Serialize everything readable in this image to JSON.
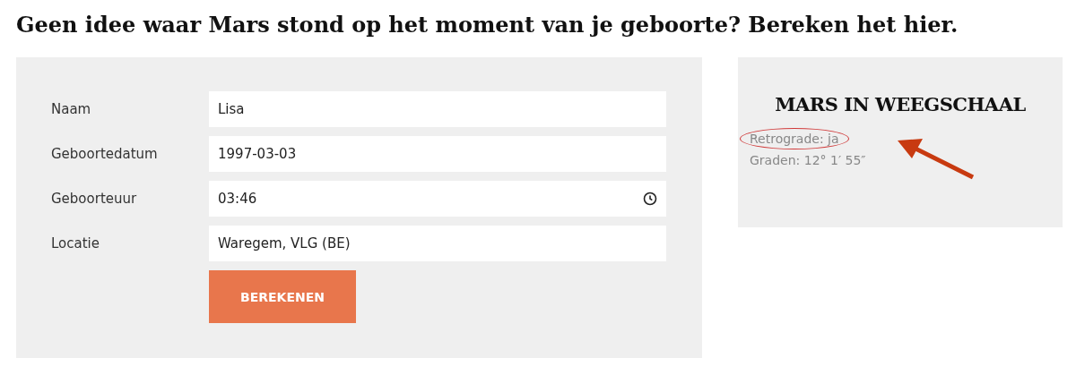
{
  "heading": "Geen idee waar Mars stond op het moment van je geboorte? Bereken het hier.",
  "form": {
    "fields": [
      {
        "label": "Naam",
        "value": "Lisa",
        "kind": "text"
      },
      {
        "label": "Geboortedatum",
        "value": "1997-03-03",
        "kind": "text"
      },
      {
        "label": "Geboorteuur",
        "value": "03:46",
        "kind": "time"
      },
      {
        "label": "Locatie",
        "value": "Waregem, VLG (BE)",
        "kind": "text"
      }
    ],
    "submit": "BEREKENEN"
  },
  "result": {
    "title": "MARS IN WEEGSCHAAL",
    "lines": [
      {
        "text": "Retrograde: ja",
        "circled": true
      },
      {
        "text": "Graden: 12° 1′ 55″",
        "circled": false
      }
    ]
  }
}
